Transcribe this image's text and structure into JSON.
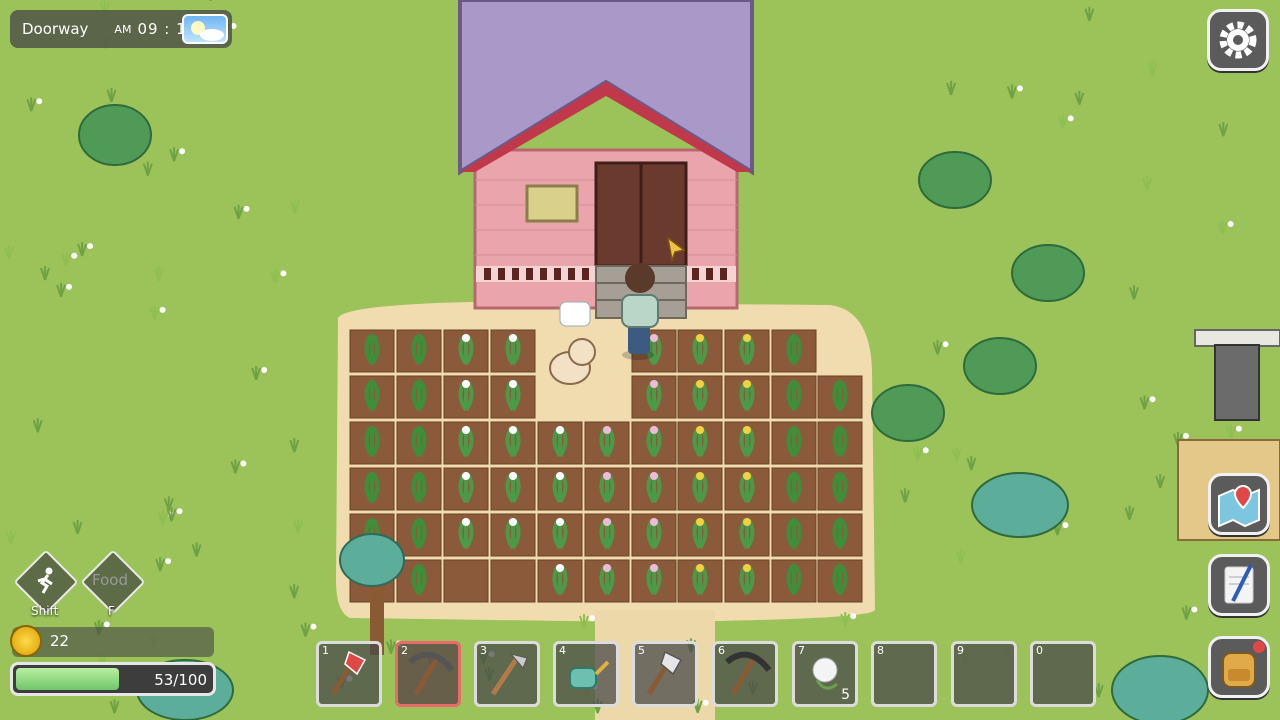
{
  "location": {
    "name": "Doorway",
    "ampm": "AM",
    "time": "09 : 10",
    "weather_icon": "sunny-sky-icon"
  },
  "skills": [
    {
      "label": "Shift",
      "icon": "running-person-icon"
    },
    {
      "label": "F",
      "icon": "food-icon",
      "icon_text": "Food"
    }
  ],
  "coins": {
    "value": "22"
  },
  "stamina": {
    "text": "53/100",
    "fraction": 0.53
  },
  "hotbar": [
    {
      "num": "1",
      "item": "axe-red-icon",
      "count": ""
    },
    {
      "num": "2",
      "item": "pickaxe-red-icon",
      "count": "",
      "selected": true
    },
    {
      "num": "3",
      "item": "hoe-icon",
      "count": ""
    },
    {
      "num": "4",
      "item": "watering-can-icon",
      "count": ""
    },
    {
      "num": "5",
      "item": "axe-icon",
      "count": ""
    },
    {
      "num": "6",
      "item": "pickaxe-icon",
      "count": ""
    },
    {
      "num": "7",
      "item": "white-flower-seeds-icon",
      "count": "5"
    },
    {
      "num": "8",
      "item": "",
      "count": ""
    },
    {
      "num": "9",
      "item": "",
      "count": ""
    },
    {
      "num": "0",
      "item": "",
      "count": ""
    }
  ],
  "right_buttons": [
    "settings-gear-icon",
    "map-pin-icon",
    "journal-pen-icon",
    "backpack-icon"
  ],
  "colors": {
    "grass": "#9cc25a",
    "roof": "#9d8fbf",
    "brick": "#e8a6ad",
    "selected_slot": "#e86a6a",
    "stamina": "#79c96d"
  }
}
